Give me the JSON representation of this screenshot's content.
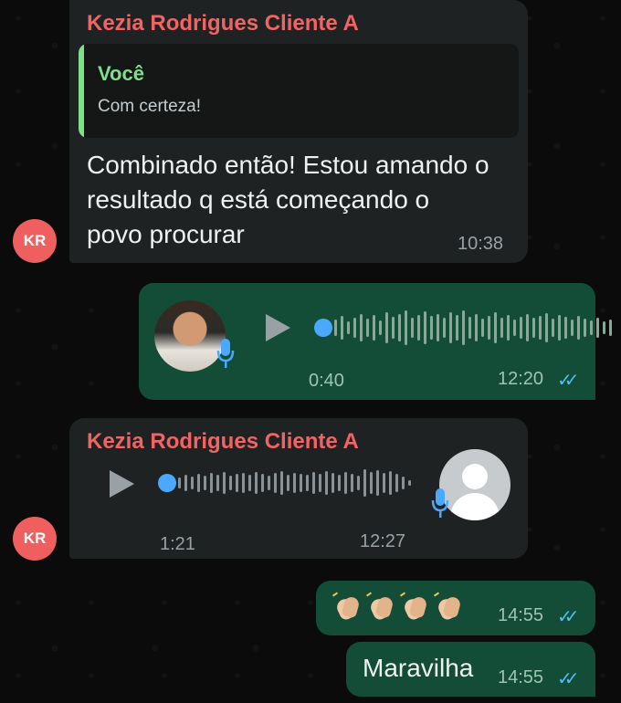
{
  "messages": [
    {
      "sender": "Kezia Rodrigues Cliente A",
      "avatar": "KR",
      "quote": {
        "author": "Você",
        "text": "Com certeza!"
      },
      "text_lines": [
        "Combinado então! Estou amando o",
        "resultado q está começando o",
        "povo procurar"
      ],
      "time": "10:38"
    },
    {
      "type": "voice",
      "duration": "0:40",
      "time": "12:20",
      "ticks": "✓✓"
    },
    {
      "sender": "Kezia Rodrigues Cliente A",
      "avatar": "KR",
      "type": "voice",
      "duration": "1:21",
      "time": "12:27"
    },
    {
      "emoji_count": 4,
      "emoji": "clapping-hands-light-skin",
      "time": "14:55",
      "ticks": "✓✓"
    },
    {
      "text": "Maravilha",
      "time": "14:55",
      "ticks": "✓✓"
    }
  ],
  "colors": {
    "incoming_bubble": "#1f2223",
    "outgoing_bubble": "#144d37",
    "sender_name": "#f06464",
    "quote_author": "#7ee08a",
    "read_ticks": "#53bdeb",
    "avatar_bg": "#ef5f5f"
  }
}
